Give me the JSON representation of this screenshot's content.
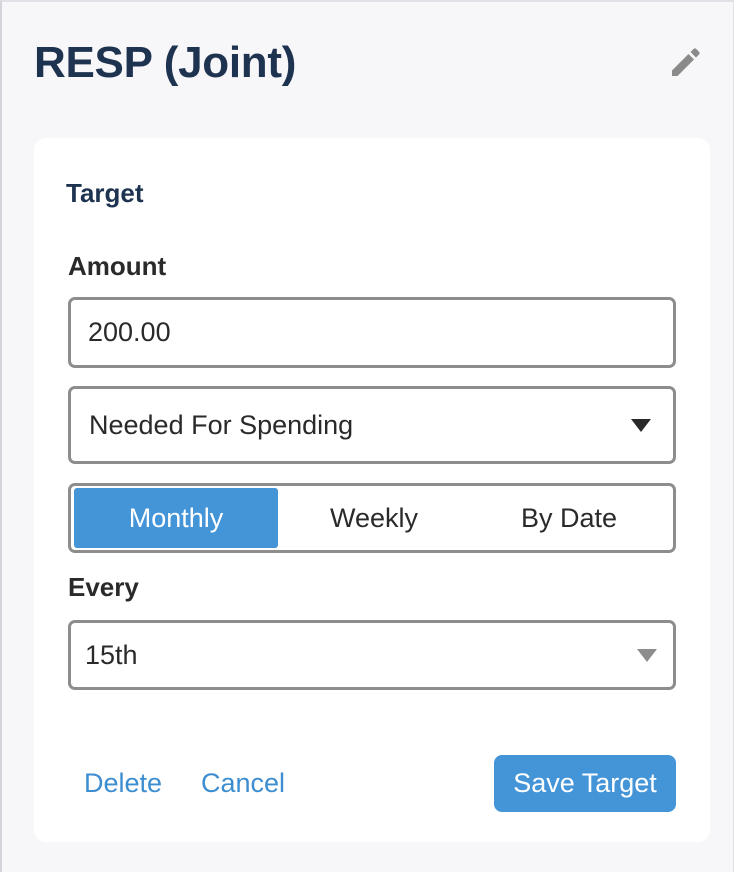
{
  "header": {
    "title": "RESP (Joint)",
    "edit_icon": "pencil-icon"
  },
  "target_form": {
    "section_title": "Target",
    "amount_label": "Amount",
    "amount_value": "200.00",
    "type_select": {
      "selected": "Needed For Spending",
      "icon": "caret-down-icon"
    },
    "frequency_options": [
      {
        "label": "Monthly",
        "selected": true
      },
      {
        "label": "Weekly",
        "selected": false
      },
      {
        "label": "By Date",
        "selected": false
      }
    ],
    "every_label": "Every",
    "every_select": {
      "selected": "15th",
      "icon": "caret-down-icon"
    },
    "delete_label": "Delete",
    "cancel_label": "Cancel",
    "save_label": "Save Target"
  },
  "colors": {
    "accent": "#4495d8",
    "title_text": "#1e3350",
    "link": "#3d8dd1",
    "background": "#f7f6f9",
    "border": "#8d8d8d"
  }
}
